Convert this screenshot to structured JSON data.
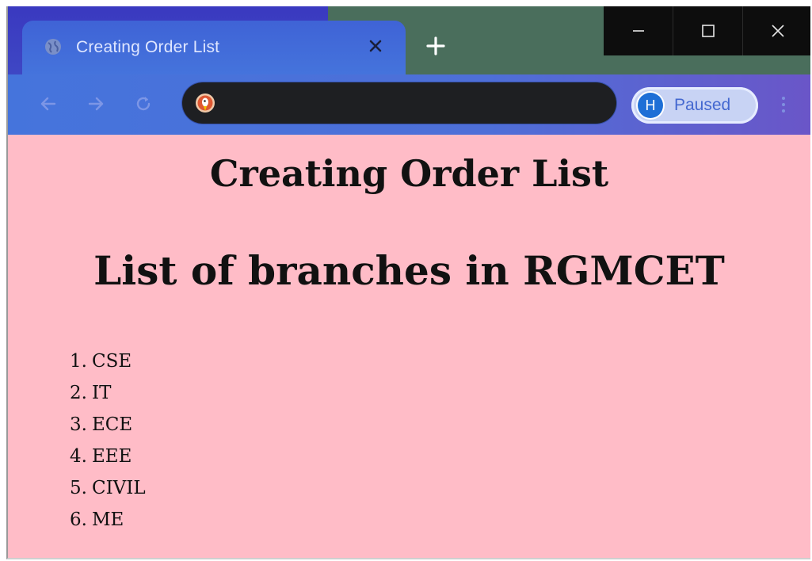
{
  "browser": {
    "tab": {
      "title": "Creating Order List"
    },
    "omnibox": {
      "value": "",
      "placeholder": ""
    },
    "profile": {
      "initial": "H",
      "status": "Paused"
    },
    "colors": {
      "tab_strip": "#3a39c0",
      "tab_strip_right": "#4a6e5c",
      "active_tab": "#4574dc",
      "omnibox_bg": "#1e1f22",
      "profile_chip": "#c8d3f4",
      "avatar": "#1e6fd6",
      "page_bg": "#ffbcc7"
    },
    "icons": {
      "favicon": "globe-icon",
      "tab_close": "close-icon",
      "new_tab": "plus-icon",
      "minimize": "minimize-icon",
      "maximize": "maximize-icon",
      "close_window": "close-icon",
      "back": "arrow-left-icon",
      "forward": "arrow-right-icon",
      "reload": "reload-icon",
      "site": "duckduckgo-icon",
      "menu": "kebab-menu-icon"
    }
  },
  "page": {
    "heading1": "Creating Order List",
    "heading2": "List of branches in RGMCET",
    "list": [
      {
        "num": "1.",
        "text": "CSE"
      },
      {
        "num": "2.",
        "text": "IT"
      },
      {
        "num": "3.",
        "text": "ECE"
      },
      {
        "num": "4.",
        "text": "EEE"
      },
      {
        "num": "5.",
        "text": "CIVIL"
      },
      {
        "num": "6.",
        "text": "ME"
      }
    ]
  }
}
